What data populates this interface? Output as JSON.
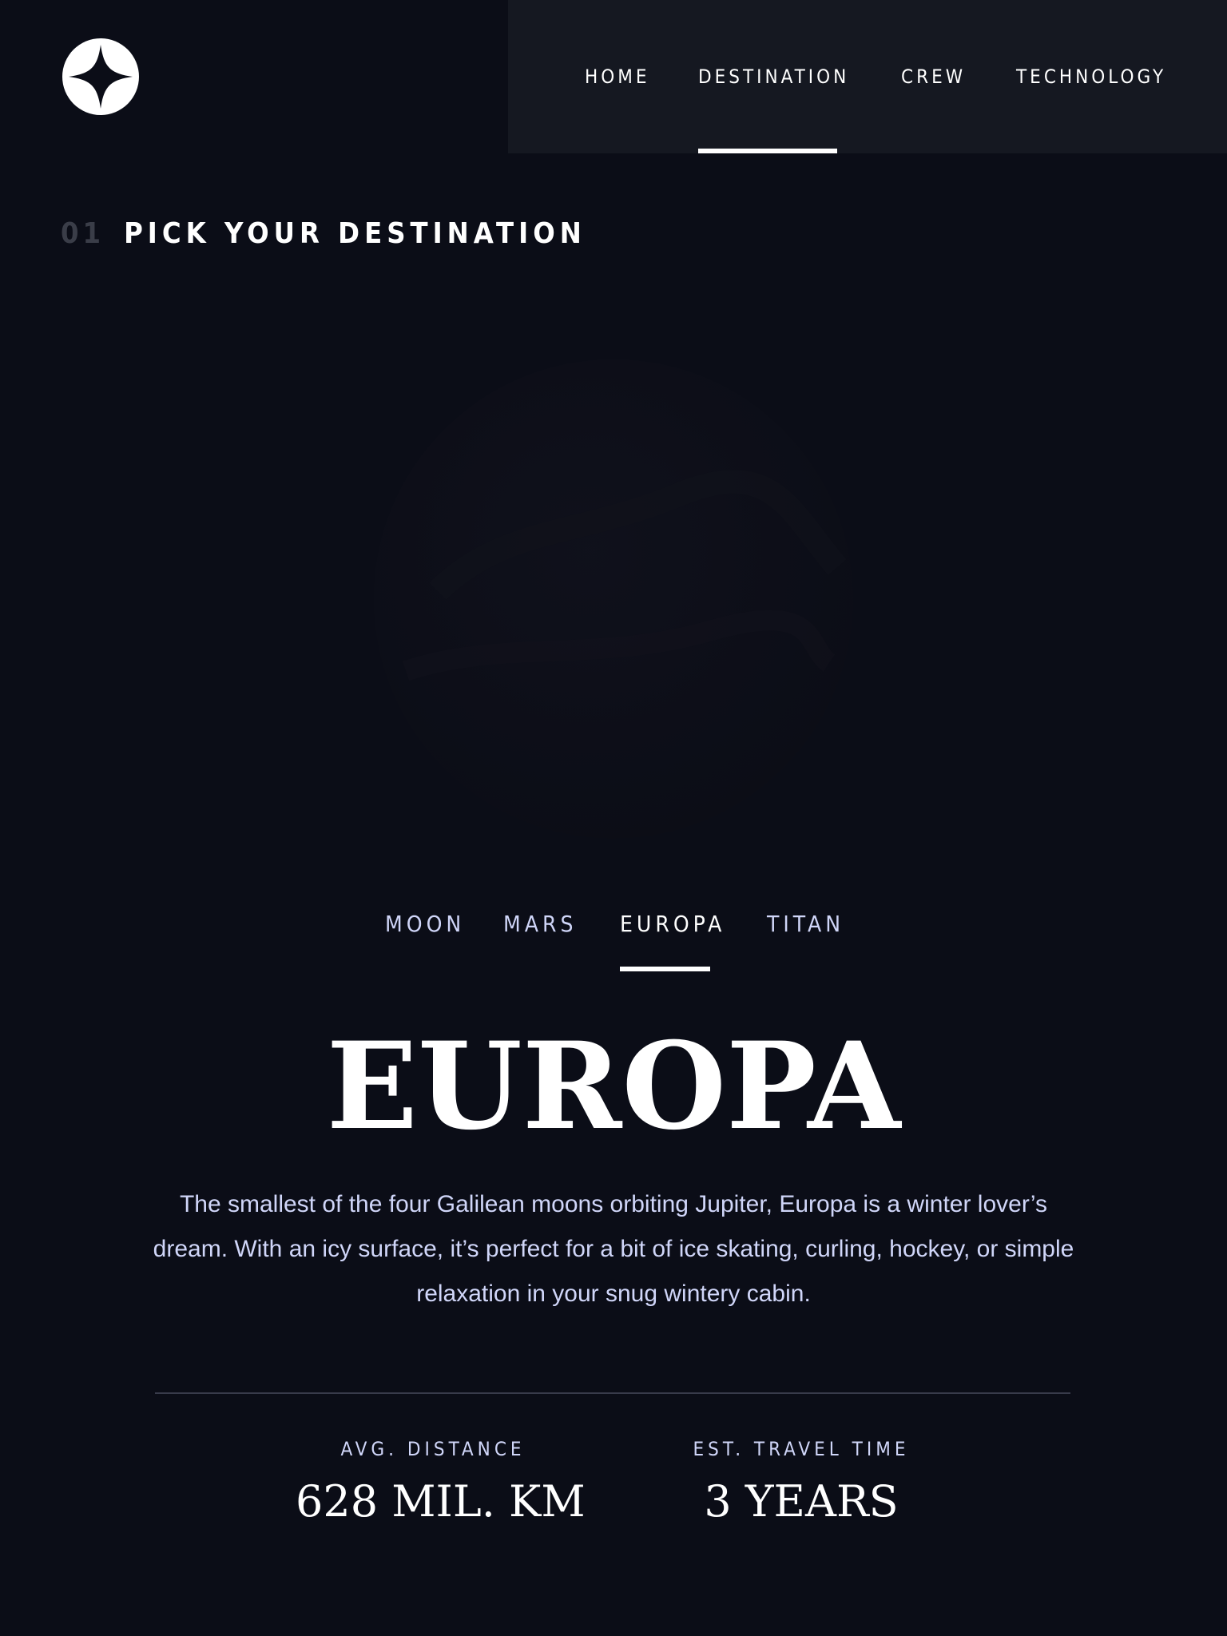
{
  "colors": {
    "background": "#0b0d17",
    "nav_background": "#151821",
    "accent_text": "#d0d6f9",
    "muted_number": "#3a3d48",
    "divider": "#383b4b"
  },
  "header": {
    "logo_icon": "four-point-star-logo-icon"
  },
  "nav": {
    "items": [
      {
        "label": "HOME",
        "active": false
      },
      {
        "label": "DESTINATION",
        "active": true
      },
      {
        "label": "CREW",
        "active": false
      },
      {
        "label": "TECHNOLOGY",
        "active": false
      }
    ]
  },
  "section": {
    "number": "01",
    "title": "PICK YOUR DESTINATION"
  },
  "destination_tabs": [
    {
      "label": "MOON",
      "active": false
    },
    {
      "label": "MARS",
      "active": false
    },
    {
      "label": "EUROPA",
      "active": true
    },
    {
      "label": "TITAN",
      "active": false
    }
  ],
  "destination": {
    "name": "EUROPA",
    "description": "The smallest of the four Galilean moons orbiting Jupiter, Europa is a winter lover’s dream. With an icy surface, it’s perfect for a bit of ice skating, curling, hockey, or simple relaxation in your snug wintery cabin.",
    "image_icon": "planet-image-dark"
  },
  "stats": {
    "distance_label": "AVG. DISTANCE",
    "distance_value": "628 MIL. KM",
    "travel_label": "EST. TRAVEL TIME",
    "travel_value": "3 YEARS"
  }
}
